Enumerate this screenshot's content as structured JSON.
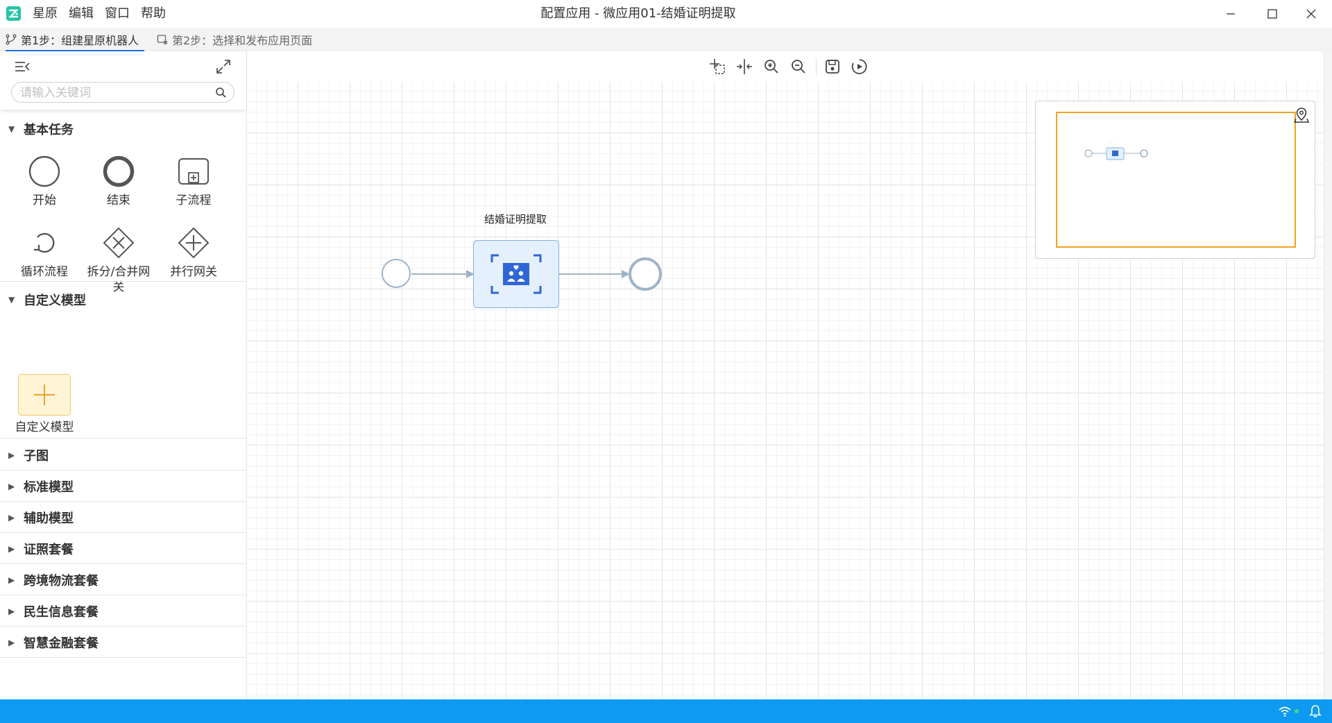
{
  "window": {
    "title": "配置应用 - 微应用01-结婚证明提取",
    "menu": [
      "星原",
      "编辑",
      "窗口",
      "帮助"
    ]
  },
  "steps": [
    {
      "label": "第1步：组建星原机器人",
      "active": true
    },
    {
      "label": "第2步：选择和发布应用页面",
      "active": false
    }
  ],
  "sidebar": {
    "search_placeholder": "请输入关键词",
    "sections": {
      "basic": {
        "title": "基本任务",
        "expanded": true,
        "tools": [
          "开始",
          "结束",
          "子流程",
          "循环流程",
          "拆分/合并网关",
          "并行网关"
        ]
      },
      "custom": {
        "title": "自定义模型",
        "expanded": true,
        "tools": [
          "自定义模型"
        ]
      },
      "collapsed": [
        "子图",
        "标准模型",
        "辅助模型",
        "证照套餐",
        "跨境物流套餐",
        "民生信息套餐",
        "智慧金融套餐"
      ]
    }
  },
  "toolbar": {
    "icons": [
      "select-region-icon",
      "align-icon",
      "zoom-in-icon",
      "zoom-out-icon",
      "save-icon",
      "run-icon"
    ]
  },
  "diagram": {
    "task_label": "结婚证明提取"
  },
  "colors": {
    "accent": "#1a73e8",
    "statusbar": "#0e9af0",
    "node_border": "#7fb0ea",
    "node_fill": "#e4f0fd",
    "minimap_view": "#f2a21c",
    "add_model_fill": "#fff4d6"
  }
}
